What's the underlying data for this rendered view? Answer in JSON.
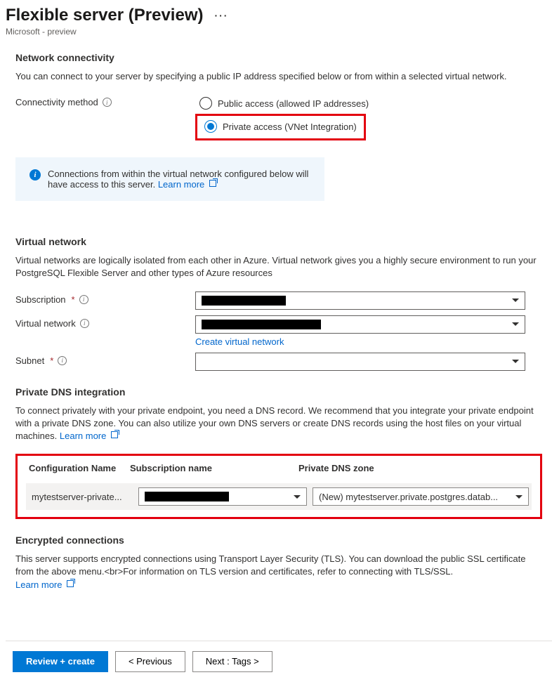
{
  "header": {
    "title": "Flexible server (Preview)",
    "subtitle": "Microsoft - preview"
  },
  "network": {
    "heading": "Network connectivity",
    "description": "You can connect to your server by specifying a public IP address specified below or from within a selected virtual network.",
    "method_label": "Connectivity method",
    "option_public": "Public access (allowed IP addresses)",
    "option_private": "Private access (VNet Integration)"
  },
  "banner": {
    "text": "Connections from within the virtual network configured below will have access to this server.",
    "link": "Learn more"
  },
  "vnet": {
    "heading": "Virtual network",
    "description": "Virtual networks are logically isolated from each other in Azure. Virtual network gives you a highly secure environment to run your PostgreSQL Flexible Server and other types of Azure resources",
    "subscription_label": "Subscription",
    "virtual_network_label": "Virtual network",
    "create_link": "Create virtual network",
    "subnet_label": "Subnet"
  },
  "dns": {
    "heading": "Private DNS integration",
    "description": "To connect privately with your private endpoint, you need a DNS record. We recommend that you integrate your private endpoint with a private DNS zone. You can also utilize your own DNS servers or create DNS records using the host files on your virtual machines.",
    "learn_more": "Learn more",
    "col1": "Configuration Name",
    "col2": "Subscription name",
    "col3": "Private DNS zone",
    "config_name": "mytestserver-private...",
    "dns_zone": "(New) mytestserver.private.postgres.datab..."
  },
  "encryption": {
    "heading": "Encrypted connections",
    "description": "This server supports encrypted connections using Transport Layer Security (TLS). You can download the public SSL certificate from the above menu.<br>For information on TLS version and certificates, refer to connecting with TLS/SSL.",
    "learn_more": "Learn more"
  },
  "footer": {
    "review": "Review + create",
    "previous": "< Previous",
    "next": "Next : Tags >"
  }
}
